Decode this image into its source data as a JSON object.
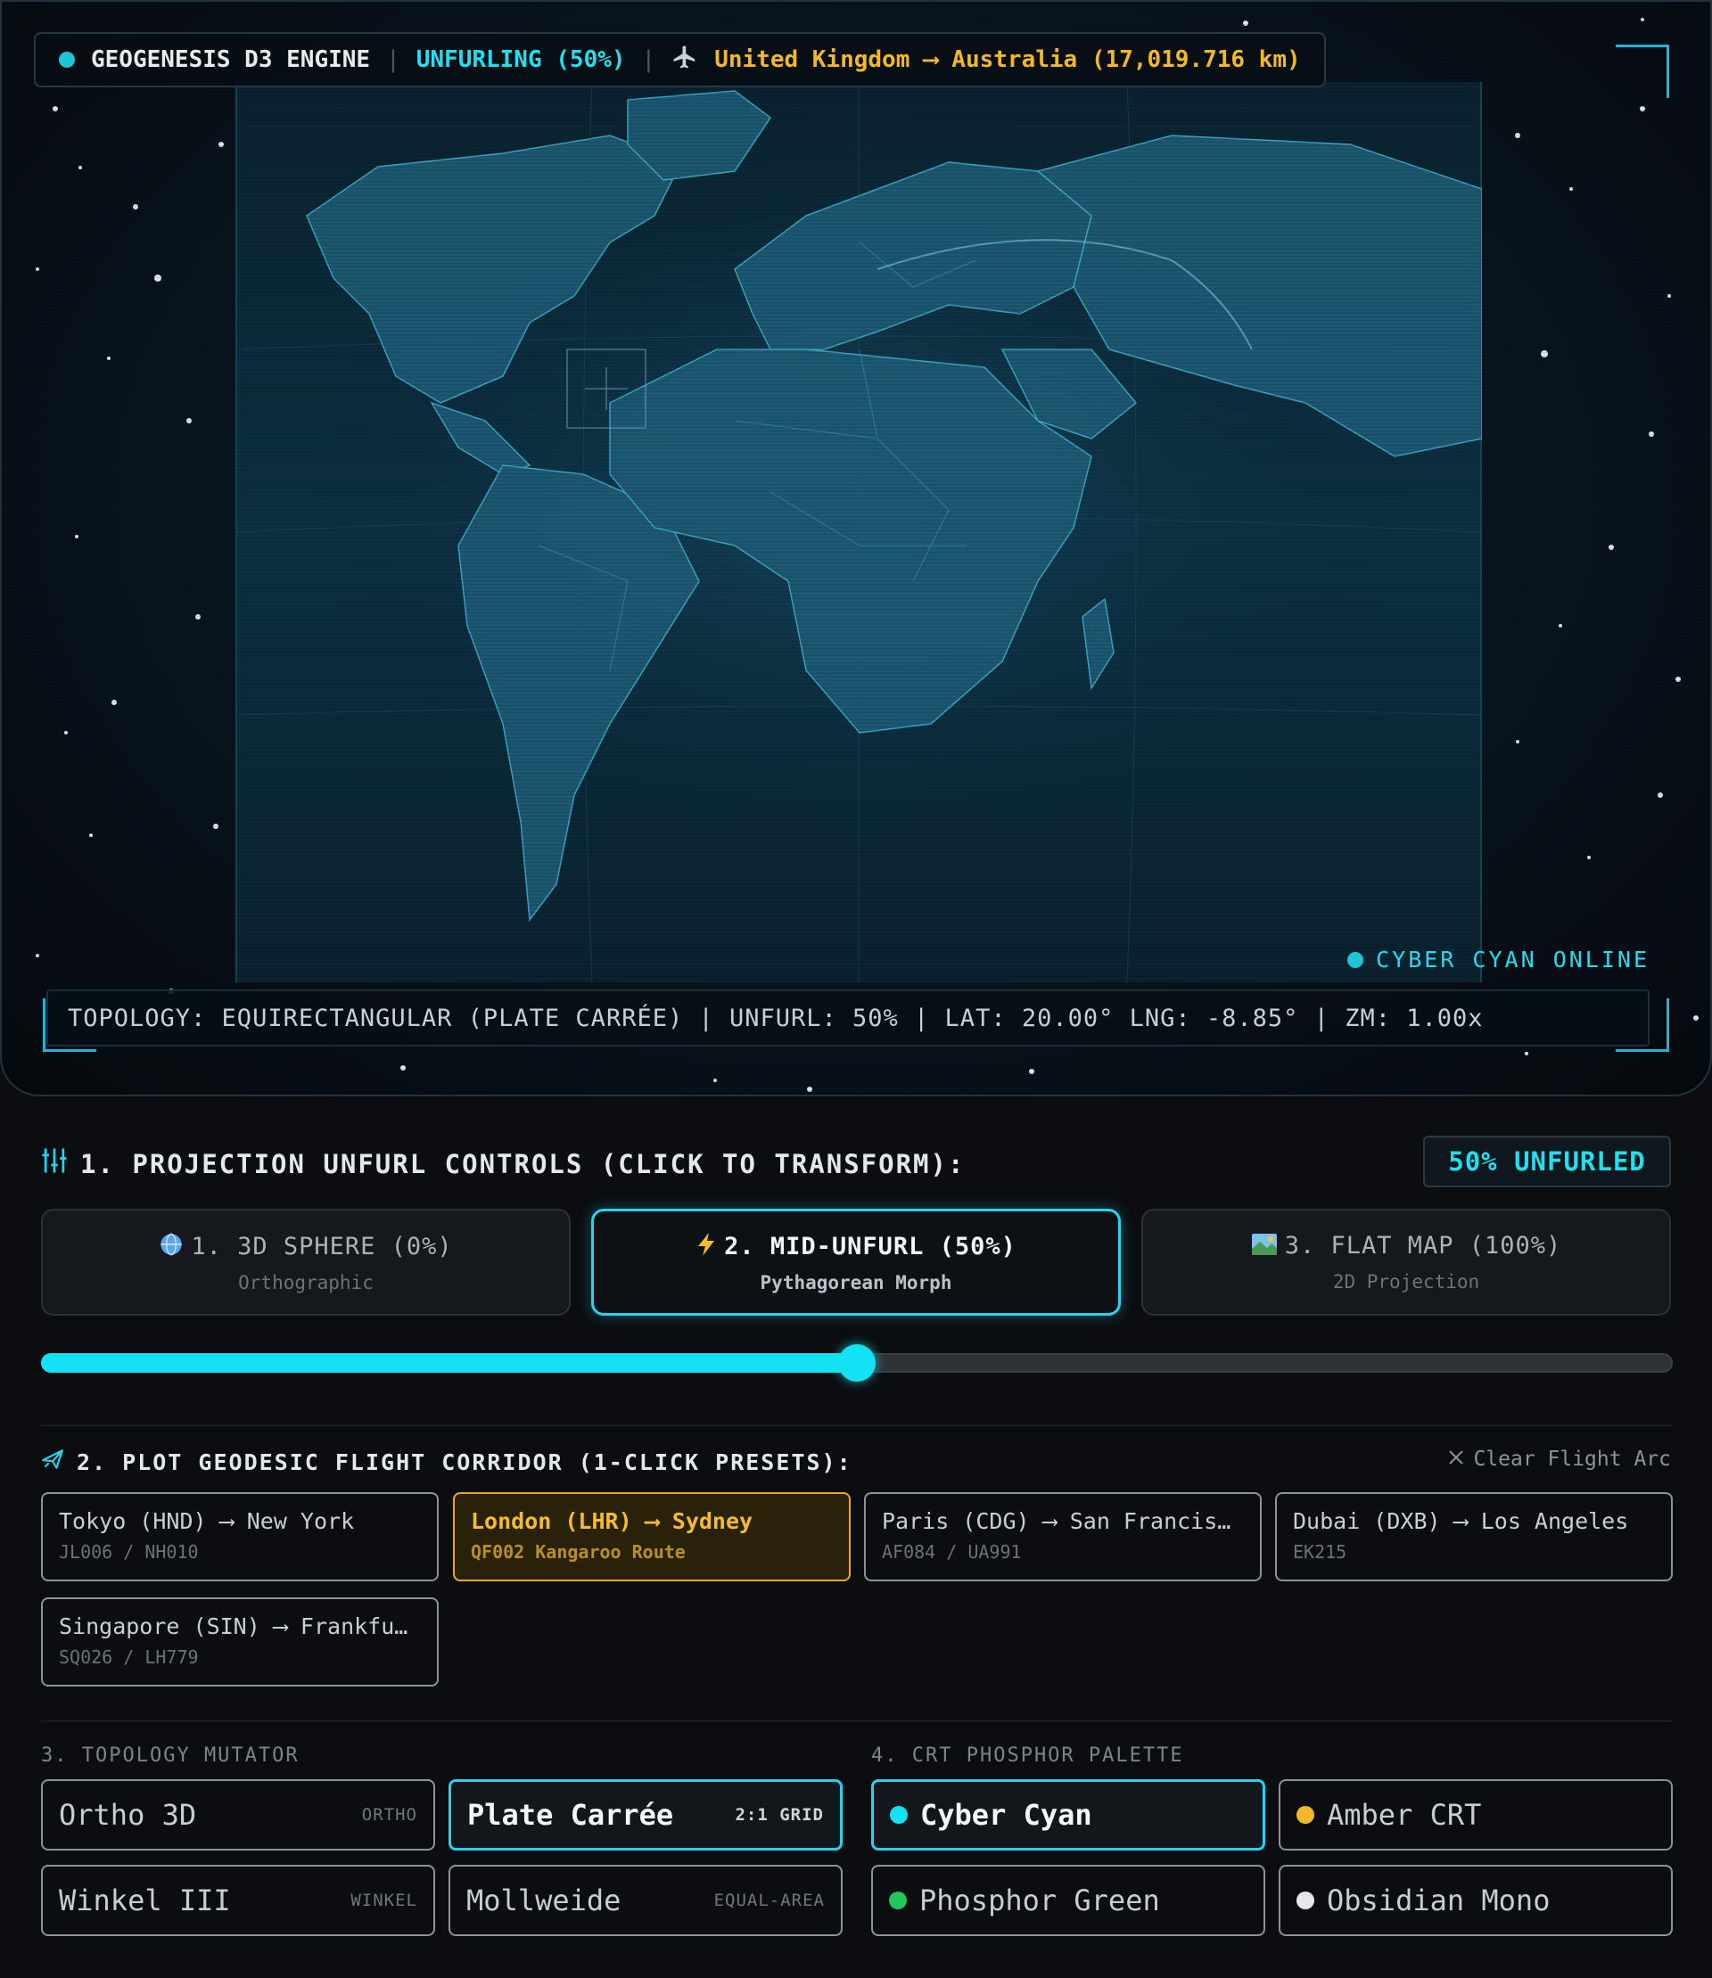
{
  "hud": {
    "engine": "GEOGENESIS D3 ENGINE",
    "sep": "|",
    "status": "UNFURLING (50%)",
    "route_icon": "airplane-icon",
    "route": "United Kingdom ⟶ Australia (17,019.716 km)",
    "online": "CYBER CYAN ONLINE",
    "readout": "TOPOLOGY: EQUIRECTANGULAR (PLATE CARRÉE) | UNFURL: 50% | LAT: 20.00° LNG: -8.85° | ZM: 1.00x"
  },
  "colors": {
    "accent": "#12e2f4",
    "amber": "#f4b826",
    "green": "#22c55e",
    "mono": "#e5e7eb"
  },
  "projection": {
    "icon": "sliders-icon",
    "heading": "1. PROJECTION UNFURL CONTROLS (CLICK TO TRANSFORM):",
    "badge": "50% UNFURLED",
    "modes": [
      {
        "icon": "globe-icon",
        "title": "1. 3D SPHERE (0%)",
        "sub": "Orthographic"
      },
      {
        "icon": "lightning-icon",
        "title": "2. MID-UNFURL (50%)",
        "sub": "Pythagorean Morph"
      },
      {
        "icon": "map-icon",
        "title": "3. FLAT MAP (100%)",
        "sub": "2D Projection"
      }
    ],
    "unfurl": 0.5
  },
  "corridor": {
    "icon": "plane-icon",
    "heading": "2. PLOT GEODESIC FLIGHT CORRIDOR (1-CLICK PRESETS):",
    "clear": "Clear Flight Arc",
    "routes": [
      {
        "title": "Tokyo (HND) ⟶ New York",
        "code": "JL006 / NH010"
      },
      {
        "title": "London (LHR) ⟶ Sydney",
        "code": "QF002 Kangaroo Route"
      },
      {
        "title": "Paris (CDG) ⟶ San Francisco",
        "code": "AF084 / UA991"
      },
      {
        "title": "Dubai (DXB) ⟶ Los Angeles",
        "code": "EK215"
      },
      {
        "title": "Singapore (SIN) ⟶ Frankfurt",
        "code": "SQ026 / LH779"
      }
    ]
  },
  "topology": {
    "label": "3. TOPOLOGY MUTATOR",
    "options": [
      {
        "label": "Ortho 3D",
        "tag": "ORTHO"
      },
      {
        "label": "Plate Carrée",
        "tag": "2:1 GRID"
      },
      {
        "label": "Winkel III",
        "tag": "WINKEL"
      },
      {
        "label": "Mollweide",
        "tag": "EQUAL-AREA"
      }
    ]
  },
  "palette": {
    "label": "4. CRT PHOSPHOR PALETTE",
    "options": [
      {
        "label": "Cyber Cyan"
      },
      {
        "label": "Amber CRT"
      },
      {
        "label": "Phosphor Green"
      },
      {
        "label": "Obsidian Mono"
      }
    ]
  }
}
